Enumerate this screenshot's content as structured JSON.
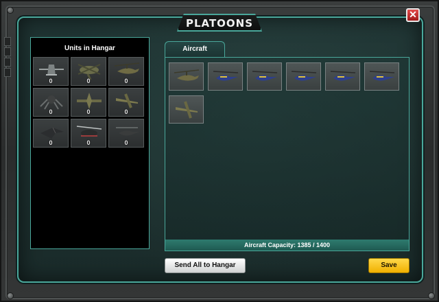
{
  "window": {
    "title": "PLATOONS",
    "close_label": "✕"
  },
  "hangar": {
    "title": "Units in Hangar",
    "units": [
      {
        "icon": "uav-drone-icon",
        "count": "0"
      },
      {
        "icon": "heavy-transport-helicopter-icon",
        "count": "0"
      },
      {
        "icon": "attack-helicopter-icon",
        "count": "0"
      },
      {
        "icon": "spider-walker-drone-icon",
        "count": "0"
      },
      {
        "icon": "bomber-aircraft-icon",
        "count": "0"
      },
      {
        "icon": "ground-attack-jet-icon",
        "count": "0"
      },
      {
        "icon": "stealth-jet-icon",
        "count": "0"
      },
      {
        "icon": "gunship-helicopter-icon",
        "count": "0"
      },
      {
        "icon": "scout-helicopter-icon",
        "count": "0"
      }
    ]
  },
  "roster": {
    "tab_label": "Aircraft",
    "units": [
      {
        "icon": "attack-helicopter-icon"
      },
      {
        "icon": "blue-scout-helicopter-icon"
      },
      {
        "icon": "blue-scout-helicopter-icon"
      },
      {
        "icon": "blue-scout-helicopter-icon"
      },
      {
        "icon": "blue-scout-helicopter-icon"
      },
      {
        "icon": "blue-scout-helicopter-icon"
      },
      {
        "icon": "ground-attack-jet-icon"
      }
    ],
    "capacity_text": "Aircraft Capacity: 1385 / 1400"
  },
  "buttons": {
    "send_all": "Send All to Hangar",
    "save": "Save"
  },
  "colors": {
    "accent": "#4aa89b",
    "save": "#f0b000",
    "close": "#c42a2a"
  }
}
